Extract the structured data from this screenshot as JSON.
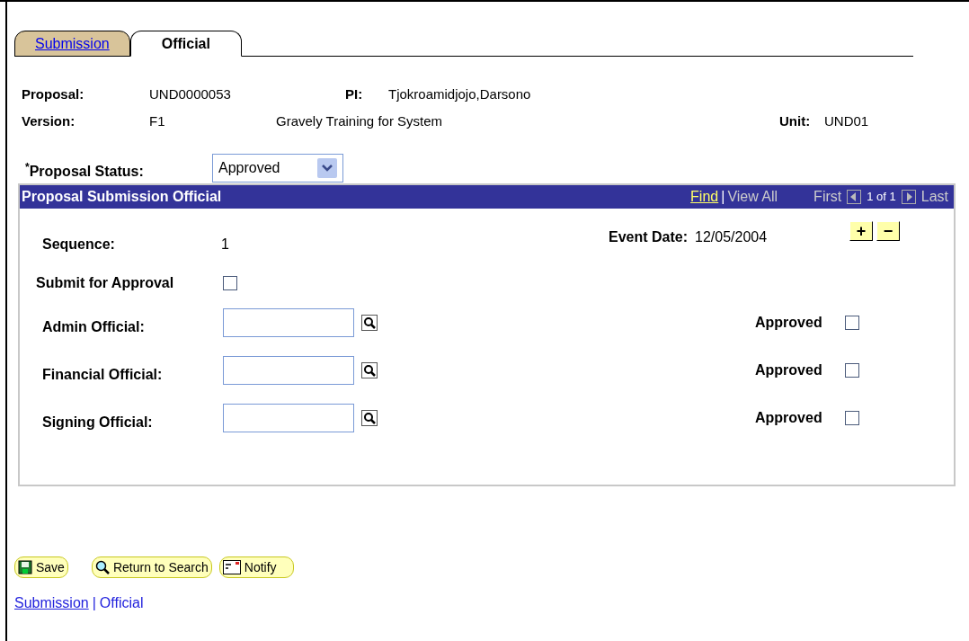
{
  "tabs": [
    {
      "label": "Submission",
      "selected": false
    },
    {
      "label": "Official",
      "selected": true
    }
  ],
  "header": {
    "proposal_label": "Proposal:",
    "proposal": "UND0000053",
    "pi_label": "PI:",
    "pi": "Tjokroamidjojo,Darsono",
    "version_label": "Version:",
    "version": "F1",
    "description": "Gravely Training for System",
    "unit_label": "Unit:",
    "unit": "UND01"
  },
  "status": {
    "required_mark": "*",
    "label": "Proposal Status:",
    "value": "Approved"
  },
  "grid": {
    "title": "Proposal Submission Official",
    "find": "Find",
    "separator": "|",
    "view_all": "View All",
    "first": "First",
    "count": "1 of 1",
    "last": "Last",
    "add": "+",
    "remove": "−",
    "sequence_label": "Sequence:",
    "sequence": "1",
    "event_date_label": "Event Date:",
    "event_date": "12/05/2004",
    "submit_label": "Submit for Approval",
    "submit_checked": false,
    "officials": [
      {
        "label": "Admin Official:",
        "approved_label": "Approved",
        "approved": false
      },
      {
        "label": "Financial Official:",
        "approved_label": "Approved",
        "approved": false
      },
      {
        "label": "Signing Official:",
        "approved_label": "Approved",
        "approved": false
      }
    ]
  },
  "buttons": [
    {
      "kind": "save",
      "label": "Save"
    },
    {
      "kind": "search",
      "label": "Return to Search"
    },
    {
      "kind": "notify",
      "label": "Notify"
    }
  ],
  "footer_links": [
    {
      "label": "Submission",
      "selected": false
    },
    {
      "label": "Official",
      "selected": true
    }
  ],
  "footer_separator": "|"
}
